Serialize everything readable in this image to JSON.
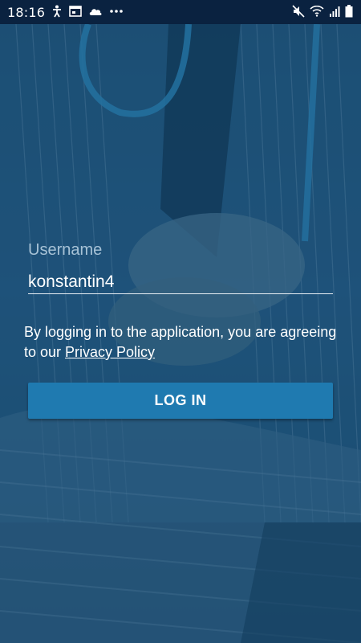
{
  "status_bar": {
    "time": "18:16",
    "left_icons": [
      "accessibility-icon",
      "calendar-icon",
      "cloud-icon",
      "more-dots-icon"
    ],
    "right_icons": [
      "mute-icon",
      "wifi-icon",
      "signal-icon",
      "battery-icon"
    ]
  },
  "login": {
    "username_label": "Username",
    "username_value": "konstantin4",
    "privacy_text_prefix": "By logging in to the application, you are agreeing to our ",
    "privacy_link_label": "Privacy Policy",
    "login_button_label": "LOG IN"
  },
  "colors": {
    "status_bar_bg": "#0a2240",
    "background_tint": "#1b4d72",
    "button_bg": "#1f7ab0",
    "label_color": "#a7c2d6",
    "text_color": "#ffffff"
  }
}
